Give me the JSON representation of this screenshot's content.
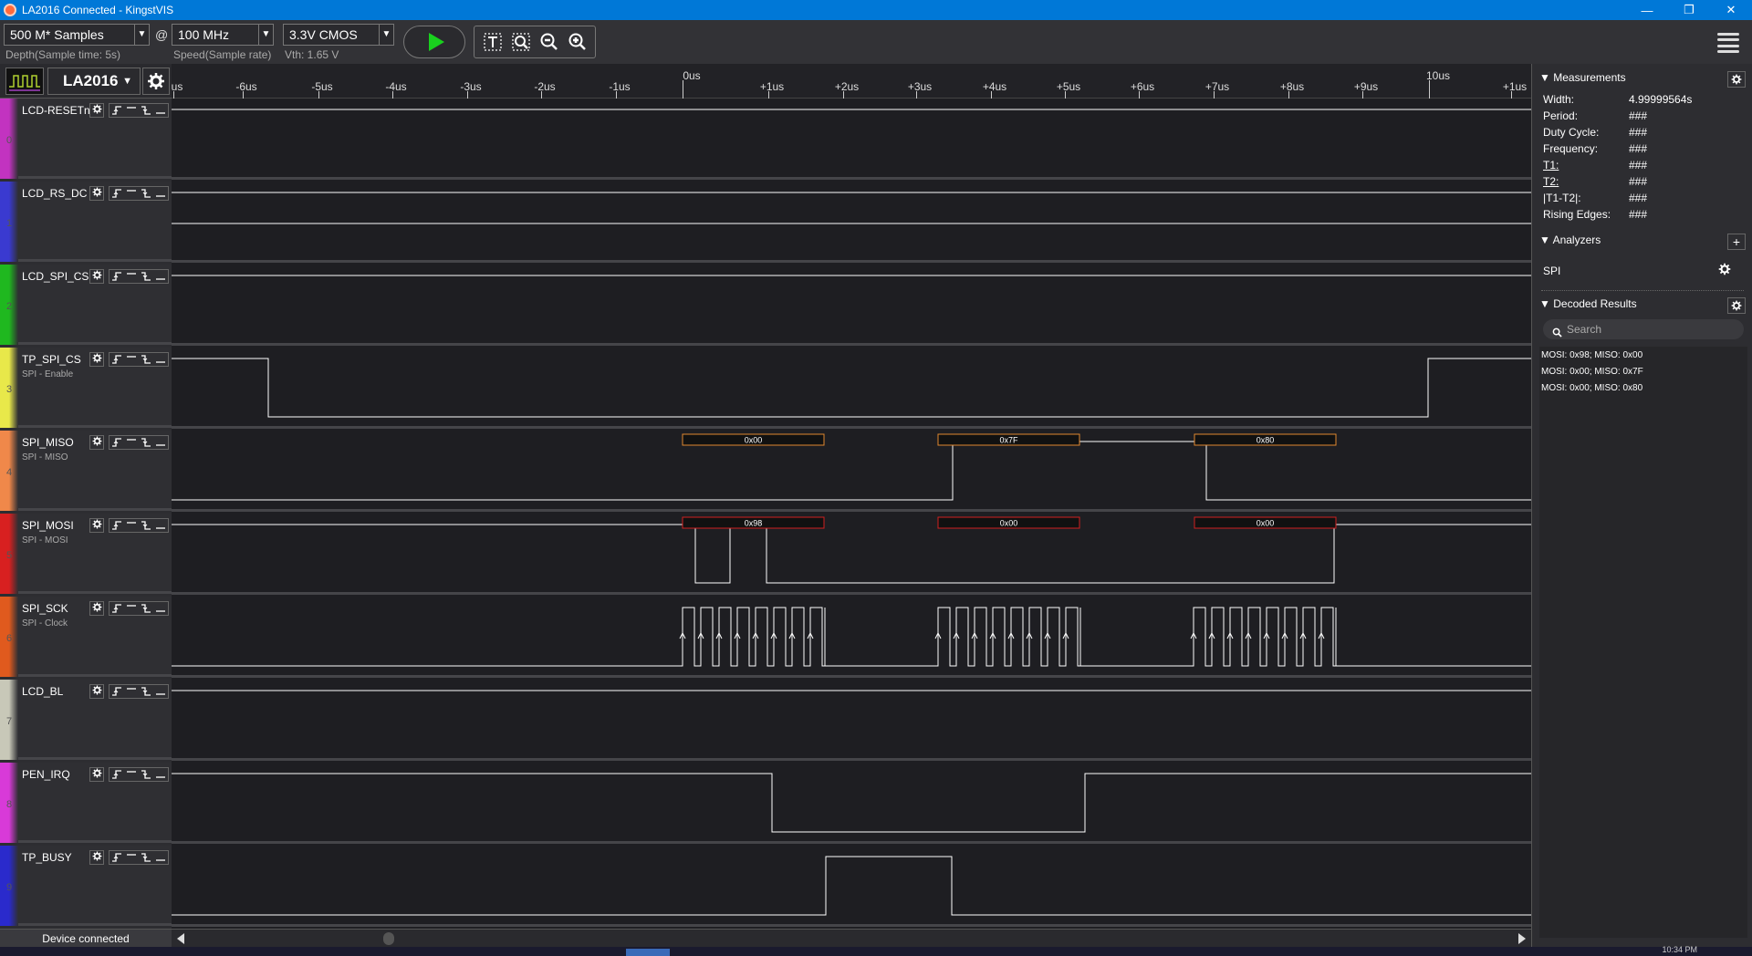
{
  "window": {
    "title": "LA2016 Connected - KingstVIS"
  },
  "toolbar": {
    "depth": "500 M* Samples",
    "depth_sub": "Depth(Sample time: 5s)",
    "at": "@",
    "speed": "100 MHz",
    "speed_sub": "Speed(Sample rate)",
    "threshold": "3.3V CMOS",
    "threshold_sub": "Vth: 1.65 V"
  },
  "device": {
    "name": "LA2016"
  },
  "status": "Device connected",
  "ruler": {
    "ticks": [
      "us",
      "-6us",
      "-5us",
      "-4us",
      "-3us",
      "-2us",
      "-1us",
      "+1us",
      "+2us",
      "+3us",
      "+4us",
      "+5us",
      "+6us",
      "+7us",
      "+8us",
      "+9us",
      "+1us"
    ],
    "major": [
      "0us",
      "10us"
    ]
  },
  "channels": [
    {
      "num": "0",
      "name": "LCD-RESETn",
      "sub": "",
      "color": "#c233c0"
    },
    {
      "num": "1",
      "name": "LCD_RS_DC",
      "sub": "",
      "color": "#3a3ad0"
    },
    {
      "num": "2",
      "name": "LCD_SPI_CS",
      "sub": "",
      "color": "#1fb81f"
    },
    {
      "num": "3",
      "name": "TP_SPI_CS",
      "sub": "SPI - Enable",
      "color": "#e8e84a"
    },
    {
      "num": "4",
      "name": "SPI_MISO",
      "sub": "SPI - MISO",
      "color": "#f0884a"
    },
    {
      "num": "5",
      "name": "SPI_MOSI",
      "sub": "SPI - MOSI",
      "color": "#d82020"
    },
    {
      "num": "6",
      "name": "SPI_SCK",
      "sub": "SPI - Clock",
      "color": "#e05a1e"
    },
    {
      "num": "7",
      "name": "LCD_BL",
      "sub": "",
      "color": "#c8c8b8"
    },
    {
      "num": "8",
      "name": "PEN_IRQ",
      "sub": "",
      "color": "#d83ad8"
    },
    {
      "num": "9",
      "name": "TP_BUSY",
      "sub": "",
      "color": "#2a2acc"
    }
  ],
  "decode_labels": {
    "miso": [
      "0x00",
      "0x7F",
      "0x80"
    ],
    "mosi": [
      "0x98",
      "0x00",
      "0x00"
    ]
  },
  "measurements": {
    "header": "Measurements",
    "rows": [
      {
        "label": "Width:",
        "value": "4.99999564s"
      },
      {
        "label": "Period:",
        "value": "###"
      },
      {
        "label": "Duty Cycle:",
        "value": "###"
      },
      {
        "label": "Frequency:",
        "value": "###"
      },
      {
        "label": "T1:",
        "value": "###"
      },
      {
        "label": "T2:",
        "value": "###"
      },
      {
        "label": "|T1-T2|:",
        "value": "###"
      },
      {
        "label": "Rising Edges:",
        "value": "###"
      }
    ]
  },
  "analyzers": {
    "header": "Analyzers",
    "items": [
      "SPI"
    ]
  },
  "decoded": {
    "header": "Decoded Results",
    "search_placeholder": "Search",
    "items": [
      "MOSI: 0x98;  MISO: 0x00",
      "MOSI: 0x00;  MISO: 0x7F",
      "MOSI: 0x00;  MISO: 0x80"
    ]
  },
  "taskbar": {
    "clock": "10:34 PM"
  }
}
